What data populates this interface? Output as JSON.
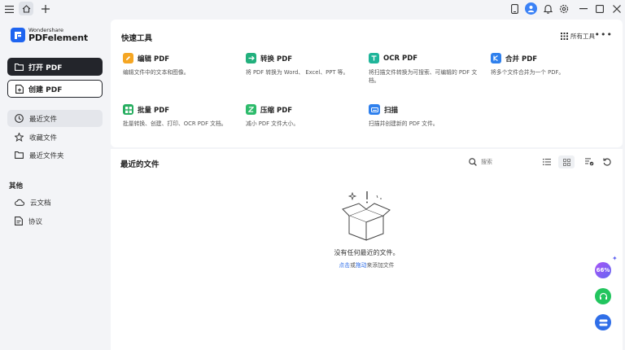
{
  "titlebar": {
    "icons": [
      "menu-icon",
      "home-icon",
      "plus-icon",
      "tablet-icon",
      "avatar",
      "bell-icon",
      "settings-icon",
      "minimize-icon",
      "maximize-icon",
      "close-icon"
    ]
  },
  "brand": {
    "company": "Wondershare",
    "product": "PDFelement",
    "color": "#1e64f0"
  },
  "sidebar": {
    "open_pdf": "打开 PDF",
    "create_pdf": "创建 PDF",
    "nav": [
      {
        "label": "最近文件",
        "icon": "clock-icon",
        "active": true
      },
      {
        "label": "收藏文件",
        "icon": "star-icon",
        "active": false
      },
      {
        "label": "最近文件夹",
        "icon": "folder-icon",
        "active": false
      }
    ],
    "other_title": "其他",
    "other": [
      {
        "label": "云文档",
        "icon": "cloud-icon"
      },
      {
        "label": "协议",
        "icon": "document-icon"
      }
    ]
  },
  "quick_tools": {
    "title": "快速工具",
    "all_tools": "所有工具",
    "tools": [
      {
        "name": "编辑 PDF",
        "desc": "编辑文件中的文本和图像。",
        "color": "#f5a623"
      },
      {
        "name": "转换 PDF",
        "desc": "将 PDF 转换为 Word、 Excel、PPT 等。",
        "color": "#22b07d"
      },
      {
        "name": "OCR PDF",
        "desc": "将扫描文件转换为可搜索、可编辑的 PDF 文档。",
        "color": "#1fb59a"
      },
      {
        "name": "合并 PDF",
        "desc": "将多个文件合并为一个 PDF。",
        "color": "#2f80ed"
      },
      {
        "name": "批量 PDF",
        "desc": "批量转换、创建、打印、OCR PDF 文档。",
        "color": "#27ae60"
      },
      {
        "name": "压缩 PDF",
        "desc": "减小 PDF 文件大小。",
        "color": "#2dbb6b"
      },
      {
        "name": "扫描",
        "desc": "扫描并创建新的 PDF 文件。",
        "color": "#2f80ed"
      }
    ]
  },
  "recent": {
    "title": "最近的文件",
    "search_placeholder": "搜索",
    "empty_text": "没有任何最近的文件。",
    "empty_link_click": "点击",
    "empty_link_or": "或",
    "empty_link_drag": "拖动",
    "empty_link_rest": "来添加文件"
  },
  "floating": {
    "percent": "66%"
  }
}
